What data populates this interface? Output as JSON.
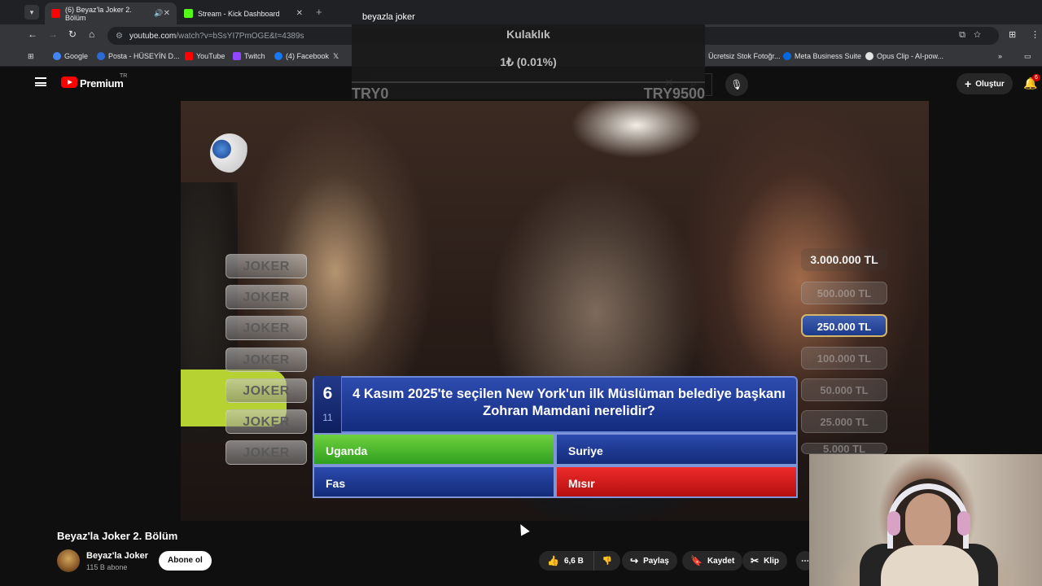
{
  "browser": {
    "tabs": [
      {
        "label": "(6) Beyaz'la Joker 2. Bölüm",
        "active": true,
        "favicon_color": "#ff0000"
      },
      {
        "label": "Stream - Kick Dashboard",
        "active": false,
        "favicon_color": "#53fc18"
      }
    ],
    "url_host": "youtube.com",
    "url_rest": "/watch?v=bSsYI7PmOGE&t=4389s",
    "bookmarks": [
      {
        "label": "Google",
        "icon": "google-icon",
        "color": "#4285f4"
      },
      {
        "label": "Posta - HÜSEYİN D...",
        "icon": "mail-icon",
        "color": "#2b6cd4"
      },
      {
        "label": "YouTube",
        "icon": "youtube-icon",
        "color": "#ff0000"
      },
      {
        "label": "Twitch",
        "icon": "twitch-icon",
        "color": "#9146ff"
      },
      {
        "label": "(4) Facebook",
        "icon": "facebook-icon",
        "color": "#1877f2"
      },
      {
        "label": "Ücretsiz Stok Fotoğr...",
        "icon": "photo-icon",
        "color": "#e3e3e3"
      },
      {
        "label": "Meta Business Suite",
        "icon": "meta-icon",
        "color": "#0668e1"
      },
      {
        "label": "Opus Clip - AI-pow...",
        "icon": "opus-icon",
        "color": "#e3e3e3"
      }
    ]
  },
  "overlay": {
    "title": "Kulaklık",
    "amount": "1₺ (0.01%)",
    "min": "TRY0",
    "max": "TRY9500"
  },
  "youtube": {
    "logo": "Premium",
    "region": "TR",
    "search_value": "beyazla joker",
    "create_label": "Oluştur",
    "notifications": "6"
  },
  "quiz": {
    "jokers": [
      "JOKER",
      "JOKER",
      "JOKER",
      "JOKER",
      "JOKER",
      "JOKER",
      "JOKER"
    ],
    "money_ladder": [
      {
        "label": "3.000.000 TL",
        "state": "top"
      },
      {
        "label": "500.000 TL",
        "state": "dim"
      },
      {
        "label": "250.000 TL",
        "state": "current"
      },
      {
        "label": "100.000 TL",
        "state": "dim"
      },
      {
        "label": "50.000 TL",
        "state": "dim"
      },
      {
        "label": "25.000 TL",
        "state": "dim"
      },
      {
        "label": "5.000 TL",
        "state": "dim"
      }
    ],
    "question_number": "6",
    "question_total": "11",
    "question": "4 Kasım 2025'te seçilen New York'un ilk Müslüman belediye başkanı Zohran Mamdani nerelidir?",
    "answers": [
      "Uganda",
      "Suriye",
      "Fas",
      "Mısır"
    ]
  },
  "video_meta": {
    "title": "Beyaz'la Joker 2. Bölüm",
    "channel": "Beyaz'la Joker",
    "subscribers": "115 B abone",
    "subscribe_label": "Abone ol",
    "likes": "6,6 B",
    "share_label": "Paylaş",
    "save_label": "Kaydet",
    "clip_label": "Klip"
  }
}
